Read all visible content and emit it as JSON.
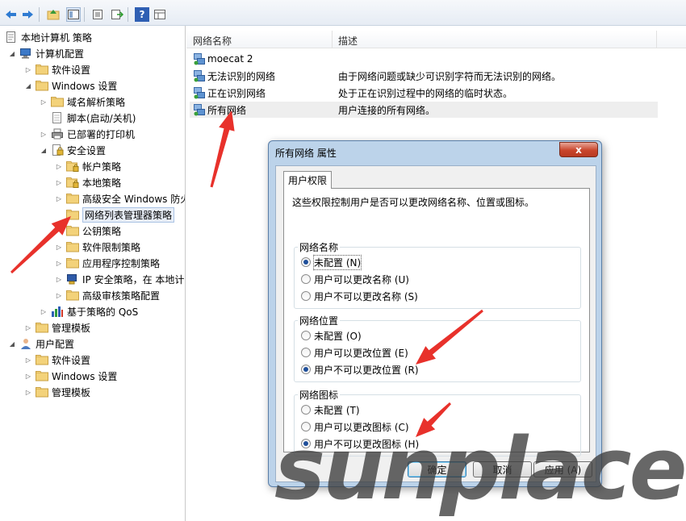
{
  "toolbar": {
    "buttons": [
      "back-icon",
      "forward-icon",
      "up-icon",
      "show-hide-tree-icon",
      "properties-icon",
      "export-icon",
      "help-icon",
      "details-icon"
    ]
  },
  "tree": {
    "items": [
      {
        "label": "本地计算机 策略",
        "depth": 0,
        "icon": "policy-icon"
      },
      {
        "label": "计算机配置",
        "depth": 1,
        "icon": "computer-icon",
        "expanded": true
      },
      {
        "label": "软件设置",
        "depth": 2,
        "icon": "folder-icon"
      },
      {
        "label": "Windows 设置",
        "depth": 2,
        "icon": "folder-icon",
        "expanded": true
      },
      {
        "label": "域名解析策略",
        "depth": 3,
        "icon": "folder-icon"
      },
      {
        "label": "脚本(启动/关机)",
        "depth": 3,
        "icon": "script-icon"
      },
      {
        "label": "已部署的打印机",
        "depth": 3,
        "icon": "printer-icon"
      },
      {
        "label": "安全设置",
        "depth": 3,
        "icon": "security-icon",
        "expanded": true
      },
      {
        "label": "帐户策略",
        "depth": 4,
        "icon": "folder-lock-icon"
      },
      {
        "label": "本地策略",
        "depth": 4,
        "icon": "folder-lock-icon"
      },
      {
        "label": "高级安全 Windows 防火",
        "depth": 4,
        "icon": "folder-icon"
      },
      {
        "label": "网络列表管理器策略",
        "depth": 4,
        "icon": "folder-icon",
        "selected": true
      },
      {
        "label": "公钥策略",
        "depth": 4,
        "icon": "folder-icon"
      },
      {
        "label": "软件限制策略",
        "depth": 4,
        "icon": "folder-icon"
      },
      {
        "label": "应用程序控制策略",
        "depth": 4,
        "icon": "folder-icon"
      },
      {
        "label": "IP 安全策略，在 本地计",
        "depth": 4,
        "icon": "ip-security-icon"
      },
      {
        "label": "高级审核策略配置",
        "depth": 4,
        "icon": "folder-icon"
      },
      {
        "label": "基于策略的 QoS",
        "depth": 3,
        "icon": "qos-chart-icon"
      },
      {
        "label": "管理模板",
        "depth": 2,
        "icon": "folder-icon"
      },
      {
        "label": "用户配置",
        "depth": 1,
        "icon": "user-icon",
        "expanded": true
      },
      {
        "label": "软件设置",
        "depth": 2,
        "icon": "folder-icon"
      },
      {
        "label": "Windows 设置",
        "depth": 2,
        "icon": "folder-icon"
      },
      {
        "label": "管理模板",
        "depth": 2,
        "icon": "folder-icon"
      }
    ]
  },
  "list": {
    "columns": [
      "网络名称",
      "描述"
    ],
    "rows": [
      {
        "name": "moecat  2",
        "desc": "",
        "icon": "network-icon"
      },
      {
        "name": "无法识别的网络",
        "desc": "由于网络问题或缺少可识别字符而无法识别的网络。",
        "icon": "network-icon"
      },
      {
        "name": "正在识别网络",
        "desc": "处于正在识别过程中的网络的临时状态。",
        "icon": "network-icon"
      },
      {
        "name": "所有网络",
        "desc": "用户连接的所有网络。",
        "icon": "network-icon"
      }
    ]
  },
  "dialog": {
    "title": "所有网络 属性",
    "close": "x",
    "tab": "用户权限",
    "description": "这些权限控制用户是否可以更改网络名称、位置或图标。",
    "groups": [
      {
        "label": "网络名称",
        "options": [
          {
            "label": "未配置 (N)",
            "checked": true
          },
          {
            "label": "用户可以更改名称 (U)",
            "checked": false
          },
          {
            "label": "用户不可以更改名称 (S)",
            "checked": false
          }
        ]
      },
      {
        "label": "网络位置",
        "options": [
          {
            "label": "未配置 (O)",
            "checked": false
          },
          {
            "label": "用户可以更改位置 (E)",
            "checked": false
          },
          {
            "label": "用户不可以更改位置 (R)",
            "checked": true
          }
        ]
      },
      {
        "label": "网络图标",
        "options": [
          {
            "label": "未配置 (T)",
            "checked": false
          },
          {
            "label": "用户可以更改图标 (C)",
            "checked": false
          },
          {
            "label": "用户不可以更改图标 (H)",
            "checked": true
          }
        ]
      }
    ],
    "buttons": {
      "ok": "确定",
      "cancel": "取消",
      "apply": "应用 (A)"
    }
  },
  "watermark": "sunplace",
  "colors": {
    "annotation_arrow": "#e8312b",
    "folder": "#f3d27a",
    "dialog_frame": "#bcd3ea"
  }
}
